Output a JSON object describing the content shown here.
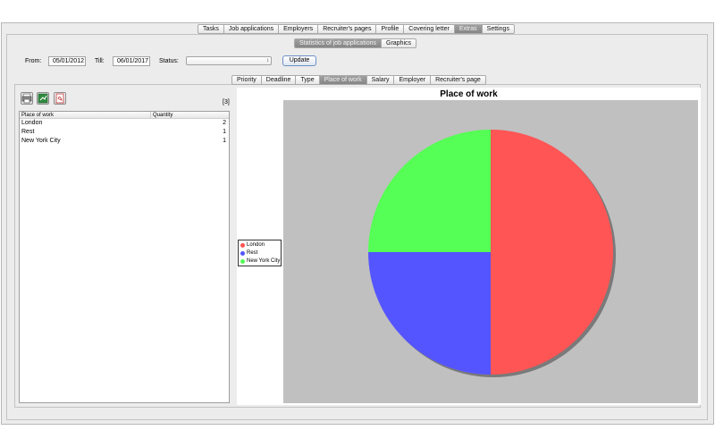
{
  "main_tabs": [
    "Tasks",
    "Job applications",
    "Employers",
    "Recruiter's pages",
    "Profile",
    "Covering letter",
    "Extras",
    "Settings"
  ],
  "main_tabs_active": 6,
  "stats_tabs": [
    "Statistics of job applications",
    "Graphics"
  ],
  "stats_tabs_active": 0,
  "filters": {
    "from_label": "From:",
    "from_value": "05/01/2012",
    "till_label": "Till:",
    "till_value": "06/01/2017",
    "status_label": "Status:",
    "status_value": "",
    "update_label": "Update"
  },
  "sub_tabs": [
    "Priority",
    "Deadline",
    "Type",
    "Place of work",
    "Salary",
    "Employer",
    "Recruiter's page"
  ],
  "sub_tabs_active": 3,
  "toolbar": {
    "icons": [
      "print-icon",
      "export-excel-icon",
      "export-pdf-icon"
    ],
    "count": "[3]"
  },
  "table": {
    "headers": [
      "Place of work",
      "Quantity"
    ],
    "rows": [
      [
        "London",
        "2"
      ],
      [
        "Rest",
        "1"
      ],
      [
        "New York City",
        "1"
      ]
    ]
  },
  "chart_data": {
    "type": "pie",
    "title": "Place of work",
    "labels": [
      "London",
      "Rest",
      "New York City"
    ],
    "values": [
      2,
      1,
      1
    ],
    "colors": [
      "#ff5555",
      "#5555ff",
      "#55ff55"
    ],
    "background": "#c0c0c0",
    "legend": "left"
  }
}
